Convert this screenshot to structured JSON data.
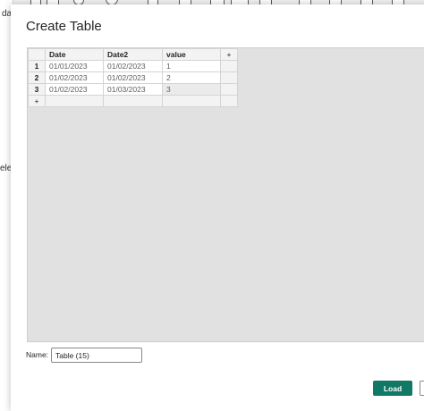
{
  "background": {
    "left_text_top": "da",
    "left_text_mid": "ele"
  },
  "dialog": {
    "title": "Create Table",
    "columns": [
      "Date",
      "Date2",
      "value"
    ],
    "add_column_label": "+",
    "add_row_label": "+",
    "rows": [
      {
        "num": "1",
        "cells": [
          "01/01/2023",
          "01/02/2023",
          "1"
        ]
      },
      {
        "num": "2",
        "cells": [
          "01/02/2023",
          "01/02/2023",
          "2"
        ]
      },
      {
        "num": "3",
        "cells": [
          "01/02/2023",
          "01/03/2023",
          "3"
        ]
      }
    ],
    "name_label": "Name:",
    "name_value": "Table (15)",
    "load_label": "Load",
    "accent_color": "#117865"
  }
}
